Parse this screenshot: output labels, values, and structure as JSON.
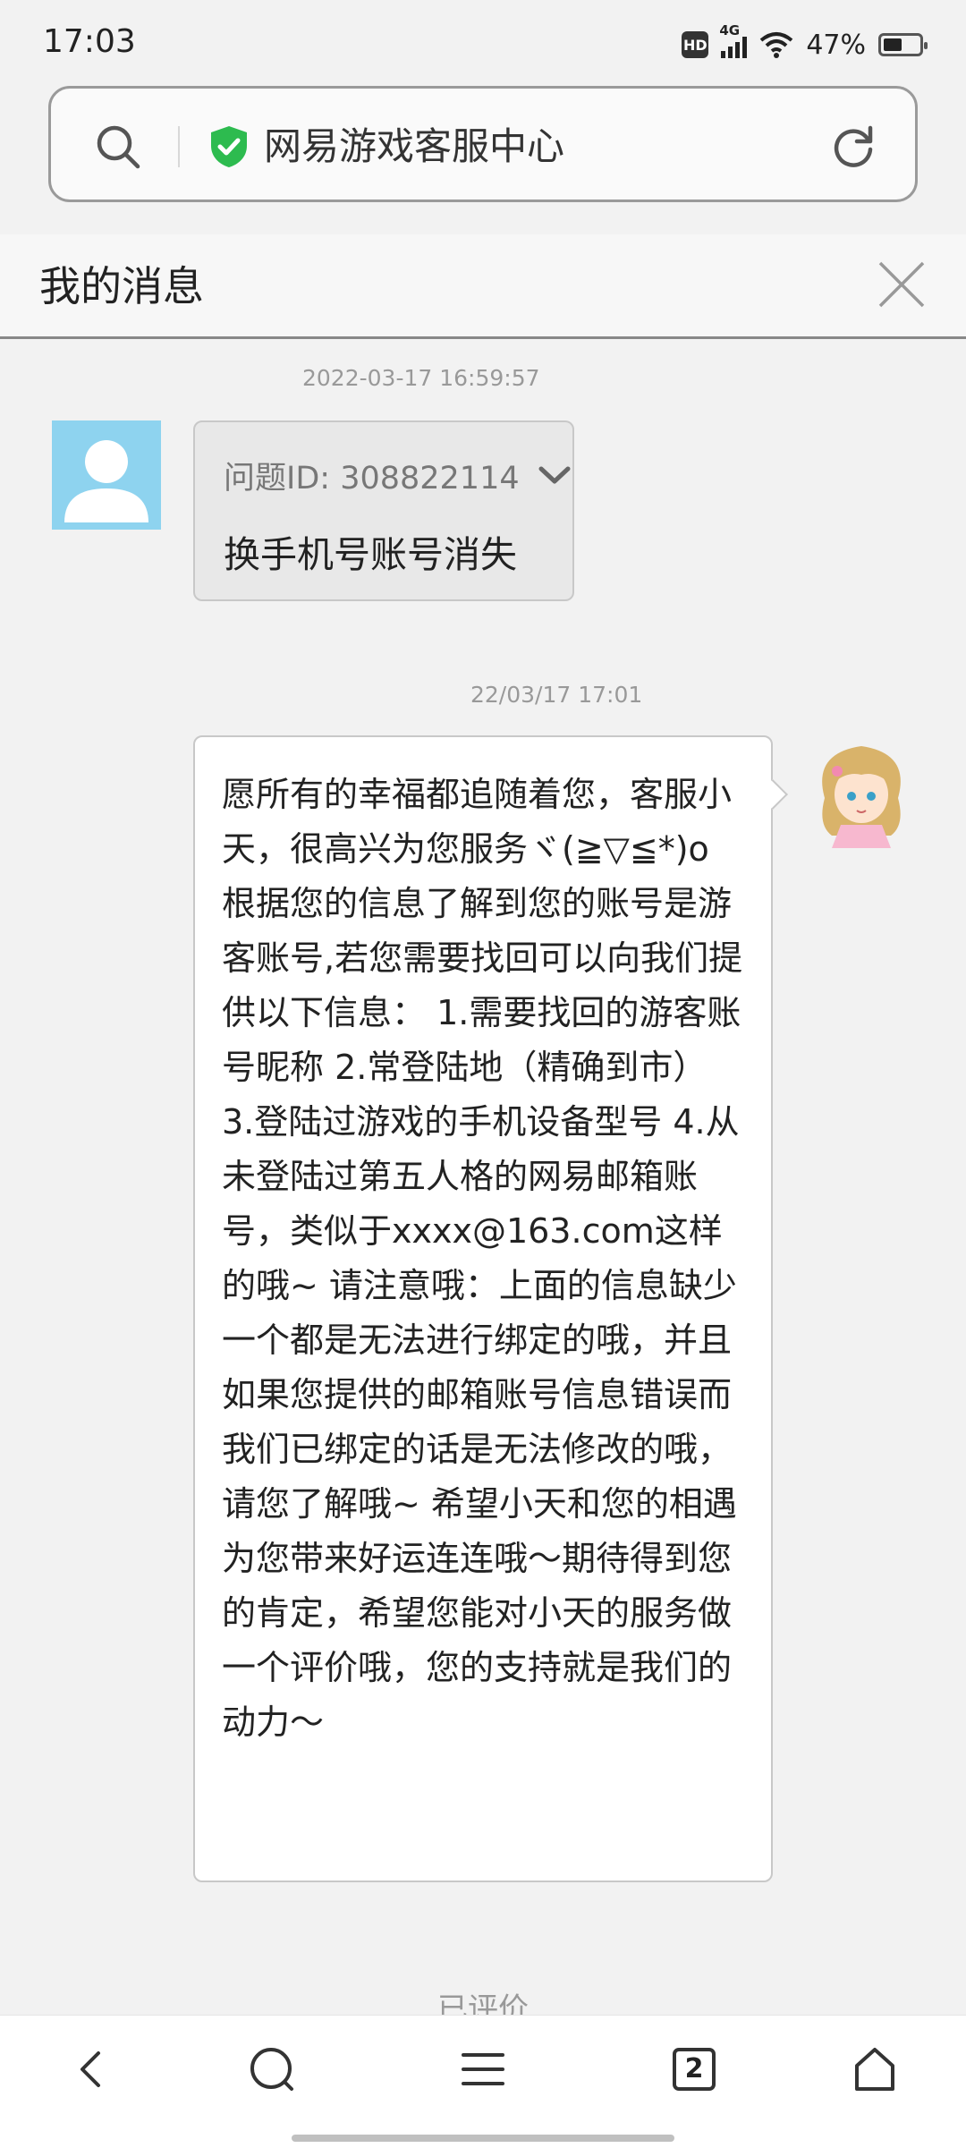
{
  "status_bar": {
    "time": "17:03",
    "hd": "HD",
    "network": "4G",
    "battery": "47%",
    "icons": [
      "hd-icon",
      "signal-icon",
      "wifi-icon",
      "battery-icon"
    ]
  },
  "address_bar": {
    "title": "网易游戏客服中心",
    "icons": [
      "search-icon",
      "shield-check-icon",
      "refresh-icon"
    ],
    "shield_color": "#2dbb4f"
  },
  "page": {
    "title": "我的消息"
  },
  "messages": [
    {
      "timestamp": "2022-03-17 16:59:57",
      "issue_id": "问题ID: 308822114",
      "text": "换手机号账号消失"
    },
    {
      "timestamp": "22/03/17 17:01",
      "text": "愿所有的幸福都追随着您，客服小天，很高兴为您服务ヾ(≧▽≦*)o 根据您的信息了解到您的账号是游客账号,若您需要找回可以向我们提供以下信息： 1.需要找回的游客账号昵称 2.常登陆地（精确到市） 3.登陆过游戏的手机设备型号 4.从未登陆过第五人格的网易邮箱账号，类似于xxxx@163.com这样的哦~ 请注意哦：上面的信息缺少一个都是无法进行绑定的哦，并且如果您提供的邮箱账号信息错误而我们已绑定的话是无法修改的哦，请您了解哦~ 希望小天和您的相遇为您带来好运连连哦～期待得到您的肯定，希望您能对小天的服务做一个评价哦，您的支持就是我们的动力～"
    }
  ],
  "rated_text": "已评价",
  "bottom_nav": {
    "tab_count": "2",
    "icons": [
      "back-icon",
      "search-icon",
      "menu-icon",
      "tabs-icon",
      "home-icon"
    ]
  },
  "colors": {
    "avatar_user_bg": "#8ed3ef",
    "bubble_user_bg": "#e8e8e8",
    "bubble_agent_bg": "#ffffff"
  }
}
